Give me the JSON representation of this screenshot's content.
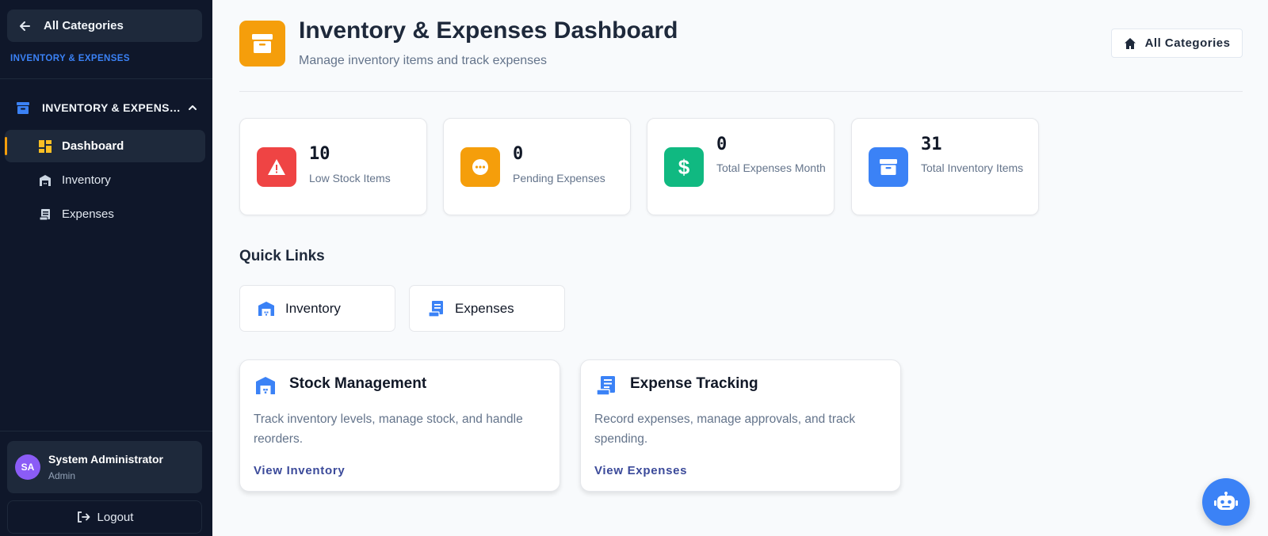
{
  "sidebar": {
    "back_label": "All Categories",
    "section_label": "INVENTORY & EXPENSES",
    "group_label": "INVENTORY & EXPENSES",
    "items": [
      {
        "label": "Dashboard",
        "icon": "dashboard-icon",
        "active": true
      },
      {
        "label": "Inventory",
        "icon": "warehouse-icon",
        "active": false
      },
      {
        "label": "Expenses",
        "icon": "receipt-icon",
        "active": false
      }
    ],
    "user": {
      "initials": "SA",
      "name": "System Administrator",
      "role": "Admin"
    },
    "logout_label": "Logout"
  },
  "header": {
    "title": "Inventory & Expenses Dashboard",
    "subtitle": "Manage inventory items and track expenses",
    "all_categories_label": "All Categories"
  },
  "stats": [
    {
      "value": "10",
      "label": "Low Stock Items",
      "color": "#ef4444",
      "icon": "warning-icon"
    },
    {
      "value": "0",
      "label": "Pending Expenses",
      "color": "#f59e0b",
      "icon": "pending-icon"
    },
    {
      "value": "0",
      "label": "Total Expenses Month",
      "color": "#10b981",
      "icon": "dollar-icon"
    },
    {
      "value": "31",
      "label": "Total Inventory Items",
      "color": "#3b82f6",
      "icon": "archive-icon"
    }
  ],
  "quick_links": {
    "title": "Quick Links",
    "items": [
      {
        "label": "Inventory",
        "icon": "warehouse-icon"
      },
      {
        "label": "Expenses",
        "icon": "receipt-icon"
      }
    ]
  },
  "features": [
    {
      "title": "Stock Management",
      "description": "Track inventory levels, manage stock, and handle reorders.",
      "link": "View Inventory",
      "icon": "warehouse-icon"
    },
    {
      "title": "Expense Tracking",
      "description": "Record expenses, manage approvals, and track spending.",
      "link": "View Expenses",
      "icon": "receipt-icon"
    }
  ],
  "colors": {
    "sidebar_bg": "#0f172a",
    "accent": "#f59e0b",
    "primary": "#3b82f6"
  }
}
